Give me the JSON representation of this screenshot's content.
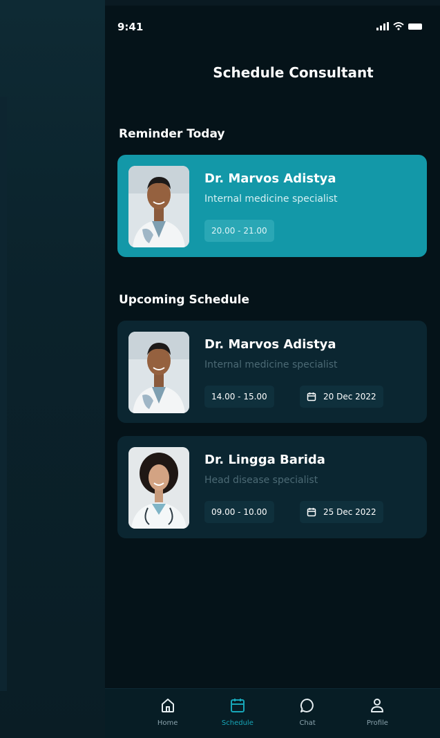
{
  "status_bar": {
    "time": "9:41"
  },
  "header": {
    "title": "Schedule Consultant"
  },
  "reminder": {
    "section_title": "Reminder Today",
    "doctor": {
      "name": "Dr. Marvos Adistya",
      "specialty": "Internal medicine specialist",
      "time": "20.00 - 21.00"
    }
  },
  "upcoming": {
    "section_title": "Upcoming Schedule",
    "items": [
      {
        "name": "Dr. Marvos Adistya",
        "specialty": "Internal medicine specialist",
        "time": "14.00 - 15.00",
        "date": "20 Dec 2022"
      },
      {
        "name": "Dr. Lingga Barida",
        "specialty": "Head disease specialist",
        "time": "09.00 - 10.00",
        "date": "25 Dec 2022"
      }
    ]
  },
  "nav": {
    "items": [
      {
        "label": "Home",
        "icon": "home-icon"
      },
      {
        "label": "Schedule",
        "icon": "calendar-icon"
      },
      {
        "label": "Chat",
        "icon": "chat-icon"
      },
      {
        "label": "Profile",
        "icon": "profile-icon"
      }
    ],
    "active": "Schedule"
  },
  "colors": {
    "accent": "#1398a8",
    "background": "#051319",
    "card": "#0b2631"
  }
}
